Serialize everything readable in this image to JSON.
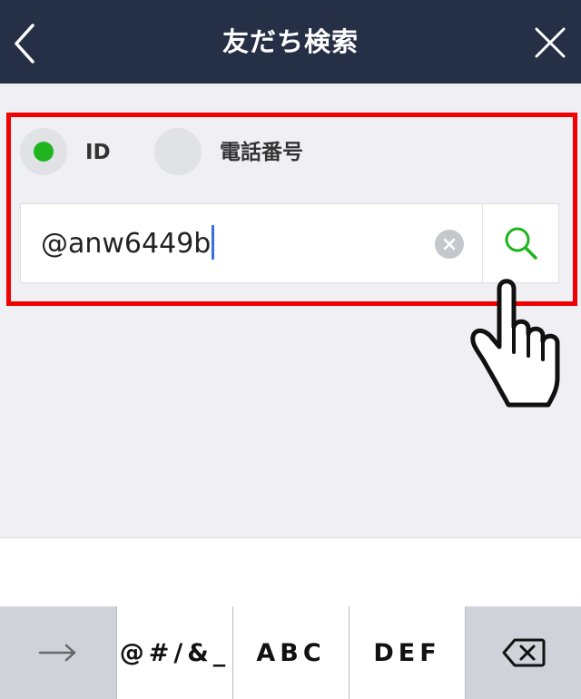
{
  "nav": {
    "title": "友だち検索"
  },
  "search_type": {
    "options": [
      {
        "label": "ID",
        "selected": true
      },
      {
        "label": "電話番号",
        "selected": false
      }
    ]
  },
  "search": {
    "value": "@anw6449b"
  },
  "keyboard": {
    "keys": [
      {
        "label": "→",
        "icon": "arrow-right-icon"
      },
      {
        "label": "@#/&_"
      },
      {
        "label": "ABC"
      },
      {
        "label": "DEF"
      },
      {
        "label": "",
        "icon": "backspace-icon"
      }
    ]
  },
  "colors": {
    "nav_bg": "#253047",
    "highlight": "#f00000",
    "radio_selected": "#1fb41e",
    "search_icon": "#1fb41e"
  }
}
